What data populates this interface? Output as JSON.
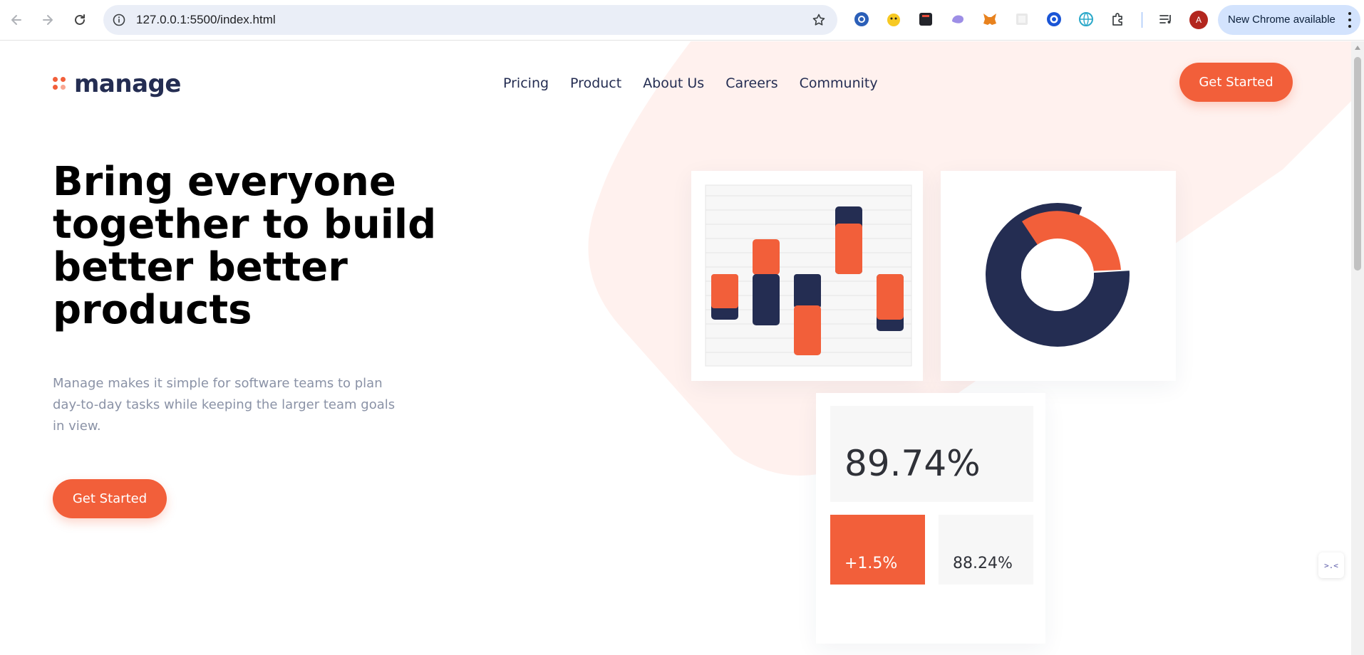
{
  "browser": {
    "url": "127.0.0.1:5500/index.html",
    "profile_initial": "A",
    "update_label": "New Chrome available",
    "extensions": [
      "extension-1-icon",
      "extension-2-icon",
      "extension-3-icon",
      "extension-4-icon",
      "metamask-icon",
      "extension-6-icon",
      "extension-7-icon",
      "extension-8-icon",
      "puzzle-icon"
    ]
  },
  "page": {
    "logo_text": "manage",
    "nav": [
      "Pricing",
      "Product",
      "About Us",
      "Careers",
      "Community"
    ],
    "header_cta": "Get Started",
    "headline": "Bring everyone together to build better better products",
    "subtext": "Manage makes it simple for software teams to plan day-to-day tasks while keeping the larger team goals in view.",
    "hero_cta": "Get Started",
    "stats": {
      "main": "89.74%",
      "change": "+1.5%",
      "secondary": "88.24%"
    },
    "chat_widget_glyph": ">.<"
  },
  "colors": {
    "accent": "#f25f3a",
    "navy": "#242d52",
    "bg_shape": "#fff1ee",
    "muted_text": "#8a92a6"
  }
}
